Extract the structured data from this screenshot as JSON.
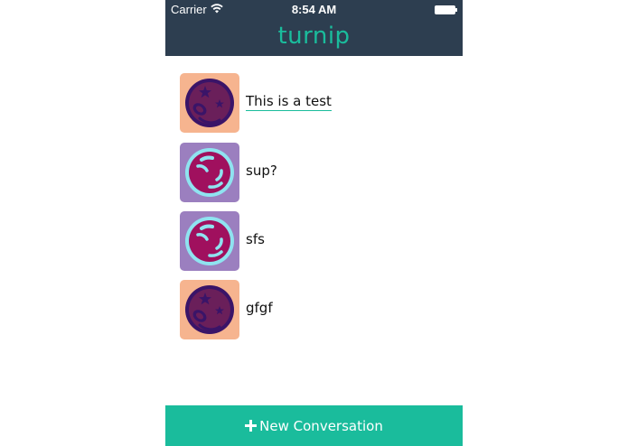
{
  "status_bar": {
    "carrier": "Carrier",
    "time": "8:54 AM"
  },
  "header": {
    "title": "turnip"
  },
  "conversations": [
    {
      "label": "This is a test",
      "avatar": "star-planet-icon"
    },
    {
      "label": "sup?",
      "avatar": "ring-planet-icon"
    },
    {
      "label": "sfs",
      "avatar": "ring-planet-icon"
    },
    {
      "label": "gfgf",
      "avatar": "star-planet-icon"
    }
  ],
  "footer": {
    "new_conversation_label": "New Conversation"
  },
  "colors": {
    "header_bg": "#2d3e50",
    "accent": "#1abc9c",
    "avatar_peach": "#f6b48f",
    "avatar_lavender": "#9b7fbf",
    "planet_dark": "#6a1f5a",
    "planet_magenta": "#a0105e",
    "ring_cyan": "#8fe3f0"
  }
}
